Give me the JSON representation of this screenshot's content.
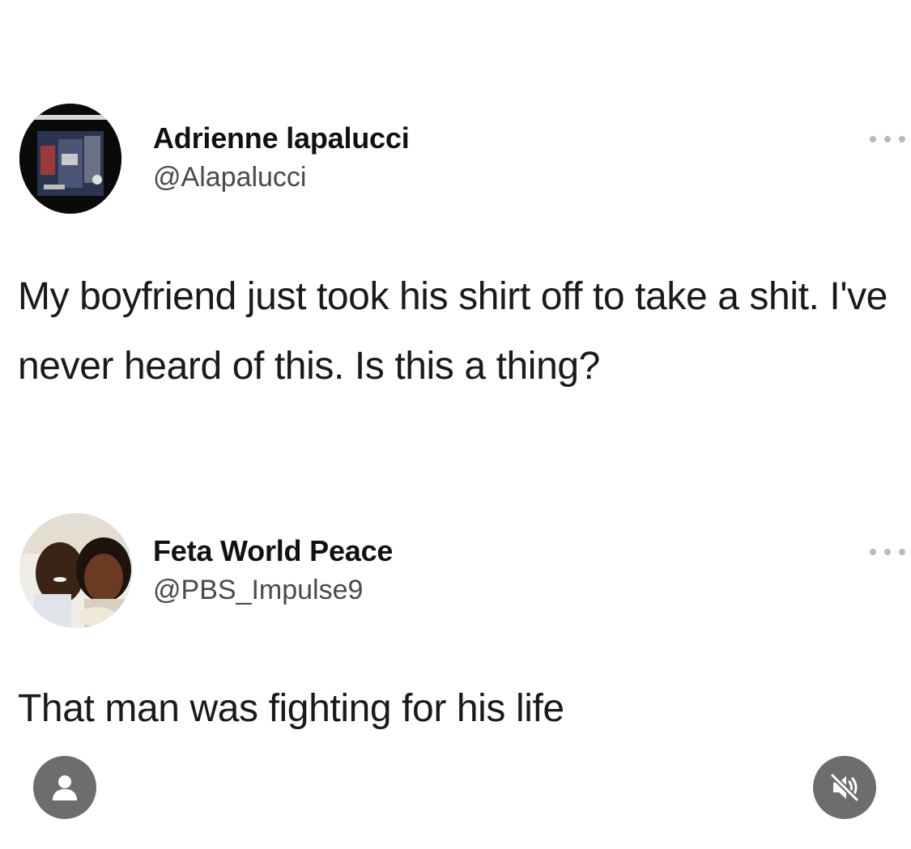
{
  "tweets": [
    {
      "name": "Adrienne lapalucci",
      "handle": "@Alapalucci",
      "text": "My boyfriend just took his shirt off to take a shit. I've never heard of this. Is this a thing?",
      "avatar_icon": "book-cover-avatar"
    },
    {
      "name": "Feta World Peace",
      "handle": "@PBS_Impulse9",
      "text": "That man was fighting for his life",
      "avatar_icon": "couple-photo-avatar"
    }
  ],
  "overlay": {
    "left_icon": "user-icon",
    "right_icon": "muted-speaker-icon",
    "button_color": "#6d6d6d"
  }
}
